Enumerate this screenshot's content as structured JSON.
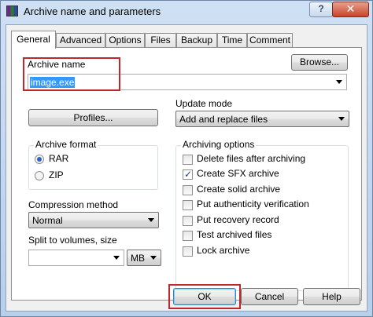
{
  "window": {
    "title": "Archive name and parameters",
    "help_label": "?",
    "close_label": "✕"
  },
  "tabs": [
    {
      "label": "General"
    },
    {
      "label": "Advanced"
    },
    {
      "label": "Options"
    },
    {
      "label": "Files"
    },
    {
      "label": "Backup"
    },
    {
      "label": "Time"
    },
    {
      "label": "Comment"
    }
  ],
  "general": {
    "archive_name_label": "Archive name",
    "browse_label": "Browse...",
    "archive_name_value": "image.exe",
    "profiles_label": "Profiles...",
    "update_mode_label": "Update mode",
    "update_mode_value": "Add and replace files",
    "archive_format": {
      "label": "Archive format",
      "options": [
        {
          "label": "RAR",
          "selected": true
        },
        {
          "label": "ZIP",
          "selected": false
        }
      ]
    },
    "compression_method_label": "Compression method",
    "compression_method_value": "Normal",
    "split_label": "Split to volumes, size",
    "split_value": "",
    "split_unit": "MB",
    "archiving_options": {
      "label": "Archiving options",
      "items": [
        {
          "label": "Delete files after archiving",
          "checked": false
        },
        {
          "label": "Create SFX archive",
          "checked": true
        },
        {
          "label": "Create solid archive",
          "checked": false
        },
        {
          "label": "Put authenticity verification",
          "checked": false
        },
        {
          "label": "Put recovery record",
          "checked": false
        },
        {
          "label": "Test archived files",
          "checked": false
        },
        {
          "label": "Lock archive",
          "checked": false
        }
      ]
    }
  },
  "footer": {
    "ok_label": "OK",
    "cancel_label": "Cancel",
    "help_label": "Help"
  },
  "colors": {
    "highlight": "#c0272d",
    "selection": "#3399ff"
  }
}
